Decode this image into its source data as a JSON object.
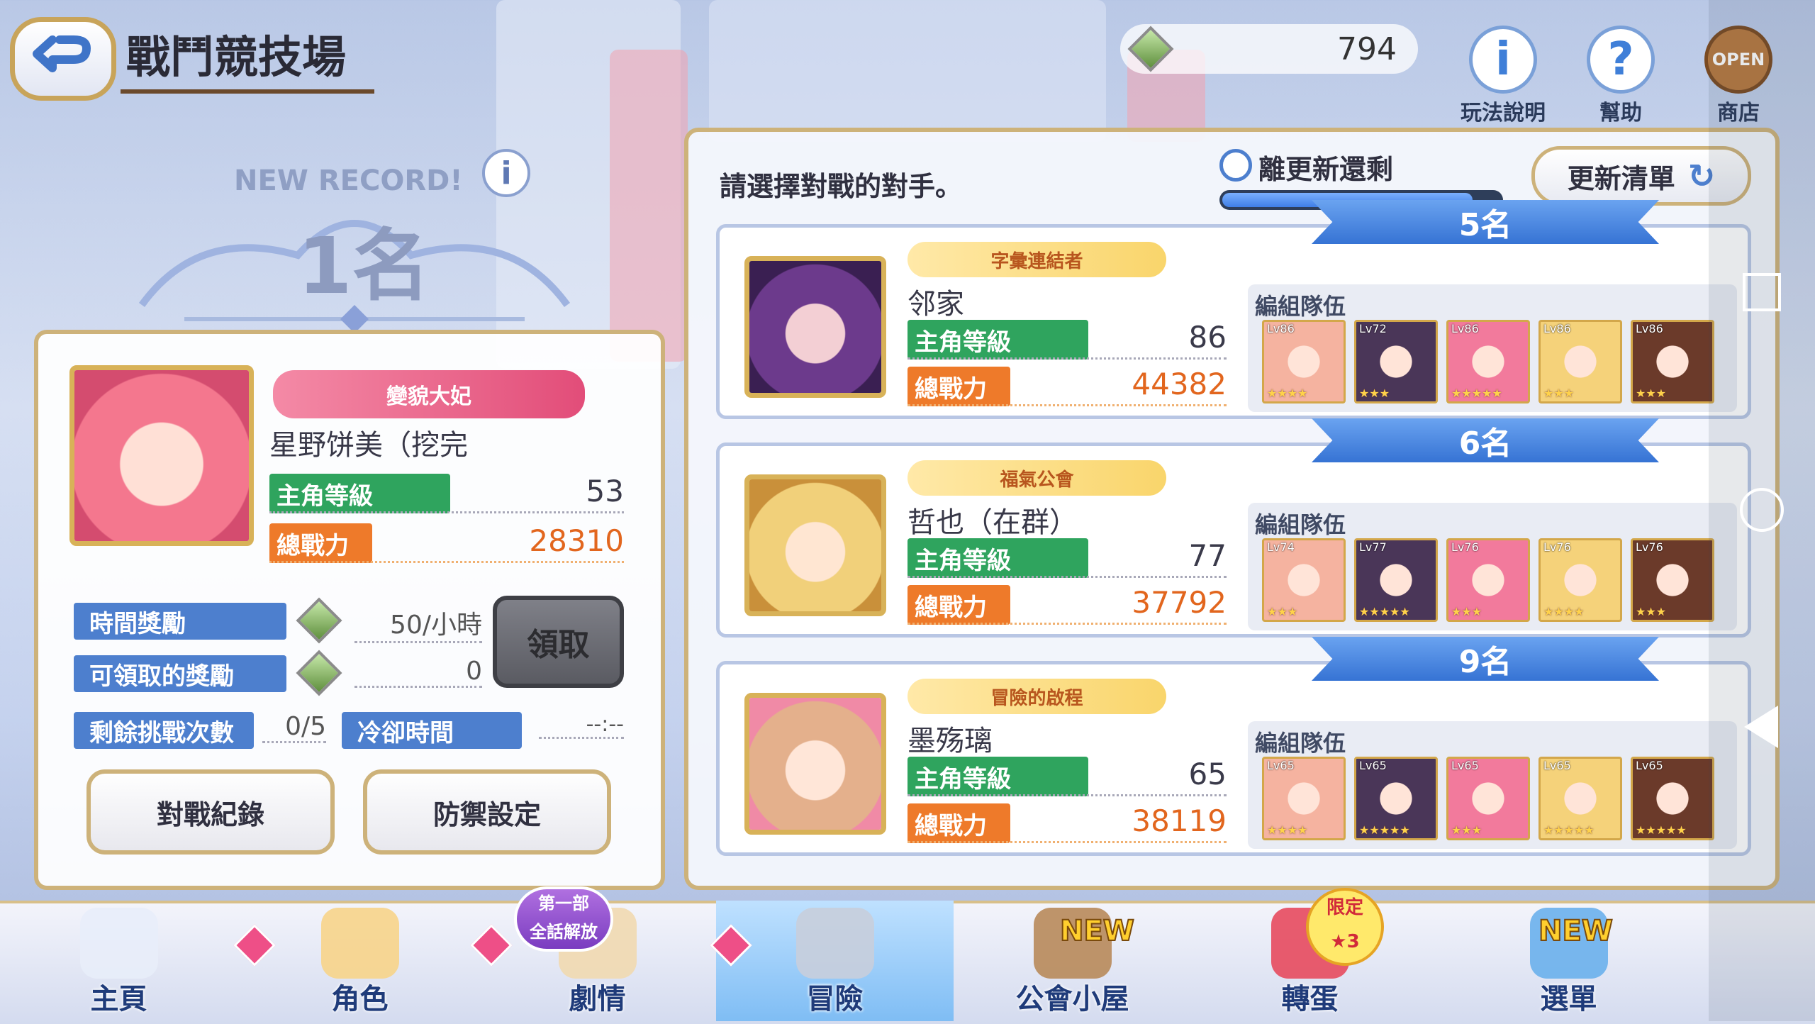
{
  "header": {
    "title": "戰鬥競技場",
    "currency_value": "794"
  },
  "top_icons": [
    {
      "name": "howto",
      "label": "玩法說明",
      "glyph": "i"
    },
    {
      "name": "help",
      "label": "幫助",
      "glyph": "?"
    },
    {
      "name": "shop",
      "label": "商店",
      "badge": "OPEN"
    }
  ],
  "player": {
    "record_label": "NEW RECORD!",
    "rank": "1名",
    "title_banner": "變貌大妃",
    "name": "星野饼美（挖完",
    "level_label": "主角等級",
    "level": "53",
    "power_label": "總戰力",
    "power": "28310"
  },
  "rewards": {
    "time_reward_label": "時間獎勵",
    "time_reward_value": "50/小時",
    "claimable_label": "可領取的獎勵",
    "claimable_value": "0",
    "claim_button": "領取",
    "remaining_label": "剩餘挑戰次數",
    "remaining_value": "0/5",
    "cooldown_label": "冷卻時間",
    "cooldown_value": "--:--"
  },
  "buttons": {
    "history": "對戰紀錄",
    "defense": "防禦設定"
  },
  "opponents_panel": {
    "prompt": "請選擇對戰的對手。",
    "timer_label": "離更新還剩",
    "timer_fraction": 0.9,
    "refresh_button": "更新清單"
  },
  "opponents": [
    {
      "rank": "5名",
      "guild": "字彙連結者",
      "name": "邻家",
      "level_label": "主角等級",
      "level": "86",
      "power_label": "總戰力",
      "power": "44382",
      "team_label": "編組隊伍",
      "team": [
        {
          "lv": "Lv86",
          "stars": "★★★★"
        },
        {
          "lv": "Lv72",
          "stars": "★★★"
        },
        {
          "lv": "Lv86",
          "stars": "★★★★★"
        },
        {
          "lv": "Lv86",
          "stars": "★★★"
        },
        {
          "lv": "Lv86",
          "stars": "★★★"
        }
      ]
    },
    {
      "rank": "6名",
      "guild": "福氣公會",
      "name": "哲也（在群）",
      "level_label": "主角等級",
      "level": "77",
      "power_label": "總戰力",
      "power": "37792",
      "team_label": "編組隊伍",
      "team": [
        {
          "lv": "Lv74",
          "stars": "★★★"
        },
        {
          "lv": "Lv77",
          "stars": "★★★★★"
        },
        {
          "lv": "Lv76",
          "stars": "★★★"
        },
        {
          "lv": "Lv76",
          "stars": "★★★★"
        },
        {
          "lv": "Lv76",
          "stars": "★★★"
        }
      ]
    },
    {
      "rank": "9名",
      "guild": "冒險的啟程",
      "name": "墨殇璃",
      "level_label": "主角等級",
      "level": "65",
      "power_label": "總戰力",
      "power": "38119",
      "team_label": "編組隊伍",
      "team": [
        {
          "lv": "Lv65",
          "stars": "★★★★"
        },
        {
          "lv": "Lv65",
          "stars": "★★★★★"
        },
        {
          "lv": "Lv65",
          "stars": "★★★"
        },
        {
          "lv": "Lv65",
          "stars": "★★★★★"
        },
        {
          "lv": "Lv65",
          "stars": "★★★★★"
        }
      ]
    }
  ],
  "nav": {
    "items": [
      "主頁",
      "角色",
      "劇情",
      "冒險",
      "公會小屋",
      "轉蛋",
      "選單"
    ],
    "story_badge": "第一部\n全話解放",
    "new_tag": "NEW",
    "limited_tag": "限定\n★3"
  },
  "colors": {
    "level_green": "#2fa45e",
    "power_orange": "#ee7a2a",
    "power_text": "#e2661e",
    "accent_blue": "#4d7fce",
    "gold": "#cdb27a"
  }
}
